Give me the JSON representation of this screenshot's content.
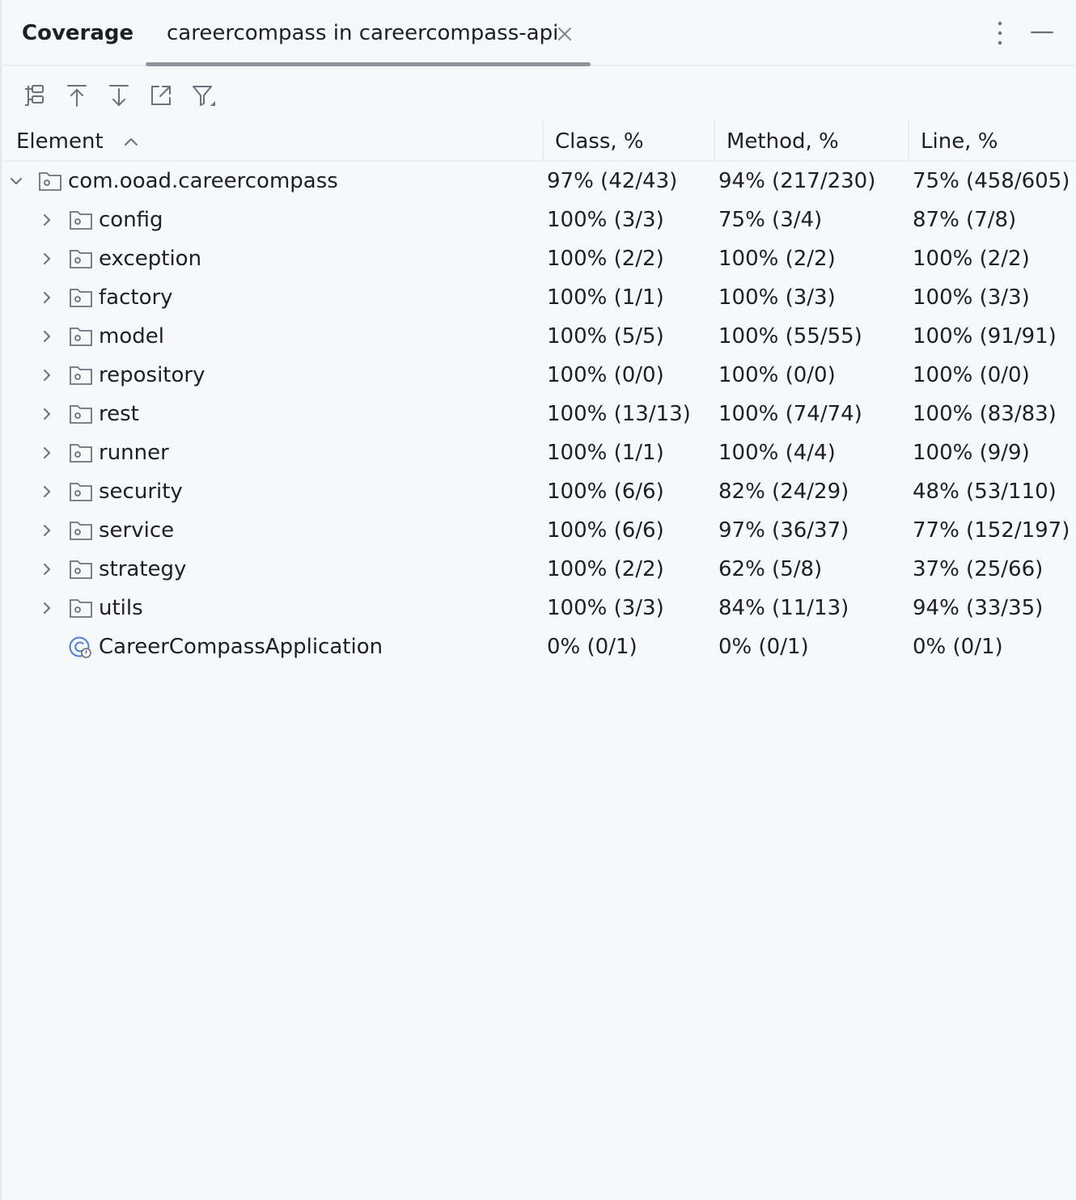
{
  "panel": {
    "title": "Coverage",
    "tab_label": "careercompass in careercompass-api"
  },
  "icons": {
    "close": "close-icon",
    "more": "more-vertical-icon",
    "minimize": "minimize-icon",
    "toolbar": [
      "flatten-packages-icon",
      "navigate-up-icon",
      "navigate-down-icon",
      "export-icon",
      "filter-icon"
    ],
    "package": "package-folder-icon",
    "class": "spring-boot-class-icon"
  },
  "table": {
    "headers": {
      "element": "Element",
      "class": "Class, %",
      "method": "Method, %",
      "line": "Line, %"
    },
    "root": {
      "name": "com.ooad.careercompass",
      "class": "97% (42/43)",
      "method": "94% (217/230)",
      "line": "75% (458/605)",
      "expanded": true
    },
    "rows": [
      {
        "name": "config",
        "class": "100% (3/3)",
        "method": "75% (3/4)",
        "line": "87% (7/8)"
      },
      {
        "name": "exception",
        "class": "100% (2/2)",
        "method": "100% (2/2)",
        "line": "100% (2/2)"
      },
      {
        "name": "factory",
        "class": "100% (1/1)",
        "method": "100% (3/3)",
        "line": "100% (3/3)"
      },
      {
        "name": "model",
        "class": "100% (5/5)",
        "method": "100% (55/55)",
        "line": "100% (91/91)"
      },
      {
        "name": "repository",
        "class": "100% (0/0)",
        "method": "100% (0/0)",
        "line": "100% (0/0)"
      },
      {
        "name": "rest",
        "class": "100% (13/13)",
        "method": "100% (74/74)",
        "line": "100% (83/83)"
      },
      {
        "name": "runner",
        "class": "100% (1/1)",
        "method": "100% (4/4)",
        "line": "100% (9/9)"
      },
      {
        "name": "security",
        "class": "100% (6/6)",
        "method": "82% (24/29)",
        "line": "48% (53/110)"
      },
      {
        "name": "service",
        "class": "100% (6/6)",
        "method": "97% (36/37)",
        "line": "77% (152/197)"
      },
      {
        "name": "strategy",
        "class": "100% (2/2)",
        "method": "62% (5/8)",
        "line": "37% (25/66)"
      },
      {
        "name": "utils",
        "class": "100% (3/3)",
        "method": "84% (11/13)",
        "line": "94% (33/35)"
      }
    ],
    "app_row": {
      "name": "CareerCompassApplication",
      "class": "0% (0/1)",
      "method": "0% (0/1)",
      "line": "0% (0/1)"
    }
  }
}
